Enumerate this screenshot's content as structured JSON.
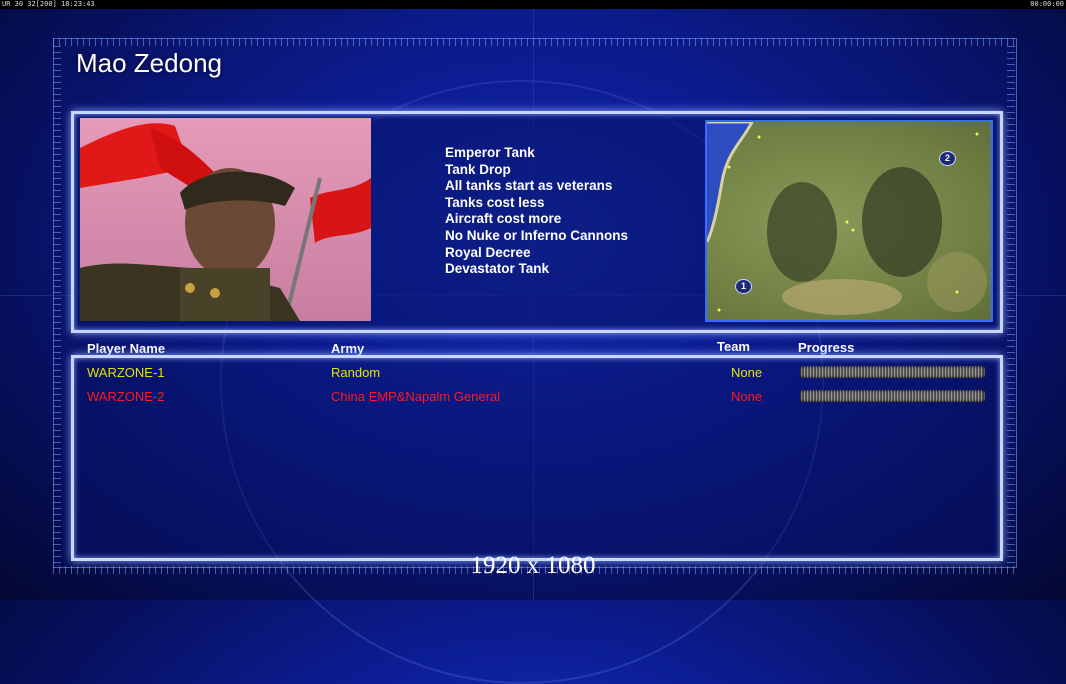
{
  "topbar": {
    "left_text": "UR 30 32[200] 18:23:43",
    "right_text": "00:00:00"
  },
  "general_name": "Mao Zedong",
  "features": [
    "Emperor Tank",
    "Tank Drop",
    "All tanks start as veterans",
    "Tanks cost less",
    "Aircraft cost more",
    "No Nuke or Inferno Cannons",
    "Royal Decree",
    "Devastator Tank"
  ],
  "minimap": {
    "markers": [
      "1",
      "2"
    ]
  },
  "columns": {
    "player": "Player Name",
    "army": "Army",
    "team": "Team",
    "progress": "Progress"
  },
  "players": [
    {
      "name": "WARZONE-1",
      "army": "Random",
      "team": "None",
      "color": "#e8e200",
      "progress": 1.0
    },
    {
      "name": "WARZONE-2",
      "army": "China EMP&Napalm General",
      "team": "None",
      "color": "#ff1a1a",
      "progress": 1.0
    }
  ],
  "resolution": "1920 x 1080"
}
